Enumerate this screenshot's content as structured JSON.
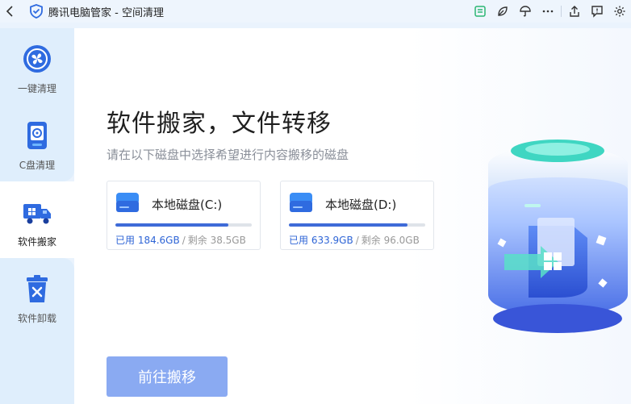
{
  "window": {
    "app_name": "腾讯电脑管家 - 空间清理",
    "back_icon": "chevron-left-icon"
  },
  "toolbar": [
    {
      "name": "message-board-icon",
      "color": "#2bb673"
    },
    {
      "name": "leaf-icon",
      "color": "#333333"
    },
    {
      "name": "umbrella-icon",
      "color": "#333333"
    },
    {
      "name": "more-icon",
      "color": "#333333"
    },
    {
      "name": "share-icon",
      "color": "#333333"
    },
    {
      "name": "feedback-icon",
      "color": "#333333"
    },
    {
      "name": "settings-icon",
      "color": "#333333"
    }
  ],
  "sidebar": {
    "items": [
      {
        "label": "一键清理",
        "icon": "fan-clean-icon",
        "active": false
      },
      {
        "label": "C盘清理",
        "icon": "disk-c-icon",
        "active": false
      },
      {
        "label": "软件搬家",
        "icon": "moving-truck-icon",
        "active": true
      },
      {
        "label": "软件卸载",
        "icon": "trash-uninstall-icon",
        "active": false
      }
    ]
  },
  "main": {
    "headline": "软件搬家，文件转移",
    "subtitle": "请在以下磁盘中选择希望进行内容搬移的磁盘",
    "disks": [
      {
        "name": "本地磁盘(C:)",
        "used_label": "已用 184.6GB",
        "separator": "/",
        "free_label": "剩余 38.5GB",
        "used_fraction": 0.827
      },
      {
        "name": "本地磁盘(D:)",
        "used_label": "已用 633.9GB",
        "separator": "/",
        "free_label": "剩余 96.0GB",
        "used_fraction": 0.868
      }
    ],
    "action_button": "前往搬移"
  },
  "colors": {
    "accent": "#3e6bd8",
    "button_disabled": "#8aaaf2",
    "sidebar_bg": "#dfeefc"
  }
}
